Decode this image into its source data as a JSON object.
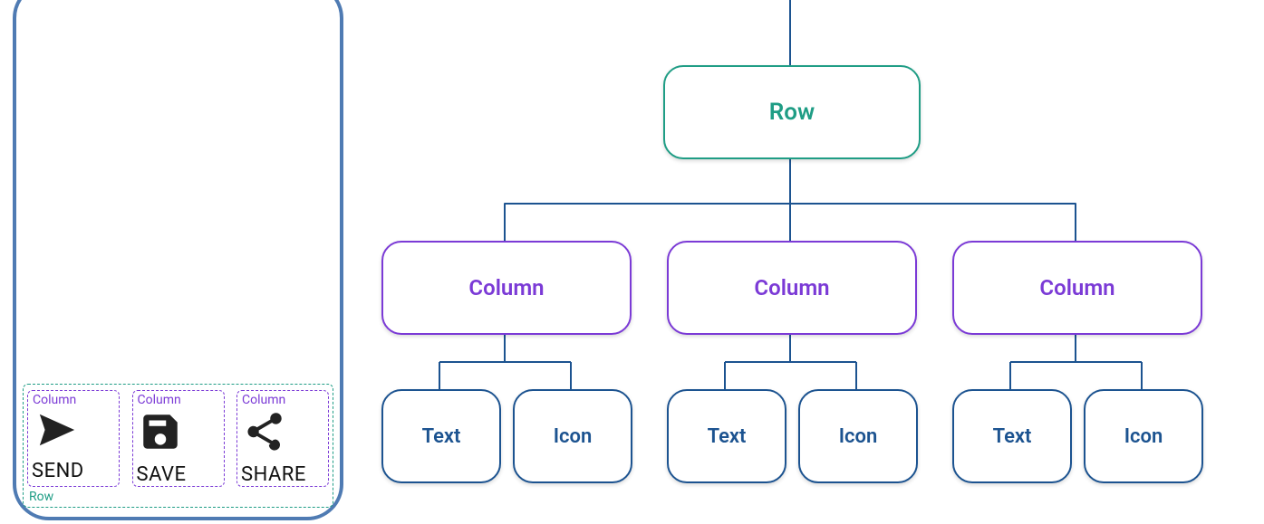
{
  "phone": {
    "row_label": "Row",
    "columns": [
      {
        "label": "Column",
        "icon": "send",
        "caption": "SEND"
      },
      {
        "label": "Column",
        "icon": "save",
        "caption": "SAVE"
      },
      {
        "label": "Column",
        "icon": "share",
        "caption": "SHARE"
      }
    ]
  },
  "tree": {
    "root": "Row",
    "child": "Column",
    "leaf_text": "Text",
    "leaf_icon": "Icon"
  }
}
